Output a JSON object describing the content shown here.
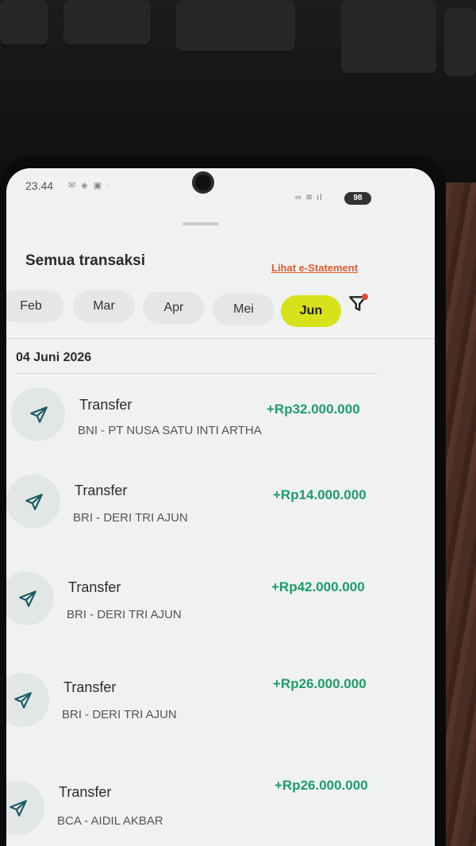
{
  "status_bar": {
    "time": "23.44",
    "battery": "98"
  },
  "header": {
    "title": "Semua transaksi",
    "estatement_link": "Lihat e-Statement"
  },
  "months": [
    {
      "label": "Feb",
      "active": false
    },
    {
      "label": "Mar",
      "active": false
    },
    {
      "label": "Apr",
      "active": false
    },
    {
      "label": "Mei",
      "active": false
    },
    {
      "label": "Jun",
      "active": true
    }
  ],
  "date_group": "04 Juni 2026",
  "transactions": [
    {
      "type": "Transfer",
      "description": "BNI - PT NUSA SATU INTI ARTHA",
      "amount": "+Rp32.000.000",
      "icon": "send-icon"
    },
    {
      "type": "Transfer",
      "description": "BRI - DERI TRI AJUN",
      "amount": "+Rp14.000.000",
      "icon": "send-icon"
    },
    {
      "type": "Transfer",
      "description": "BRI - DERI TRI AJUN",
      "amount": "+Rp42.000.000",
      "icon": "send-icon"
    },
    {
      "type": "Transfer",
      "description": "BRI - DERI TRI AJUN",
      "amount": "+Rp26.000.000",
      "icon": "send-icon"
    },
    {
      "type": "Transfer",
      "description": "BCA - AIDIL AKBAR",
      "amount": "+Rp26.000.000",
      "icon": "send-icon"
    }
  ],
  "colors": {
    "accent": "#d8e21a",
    "positive": "#1f9c6b",
    "link": "#e35a2e"
  }
}
